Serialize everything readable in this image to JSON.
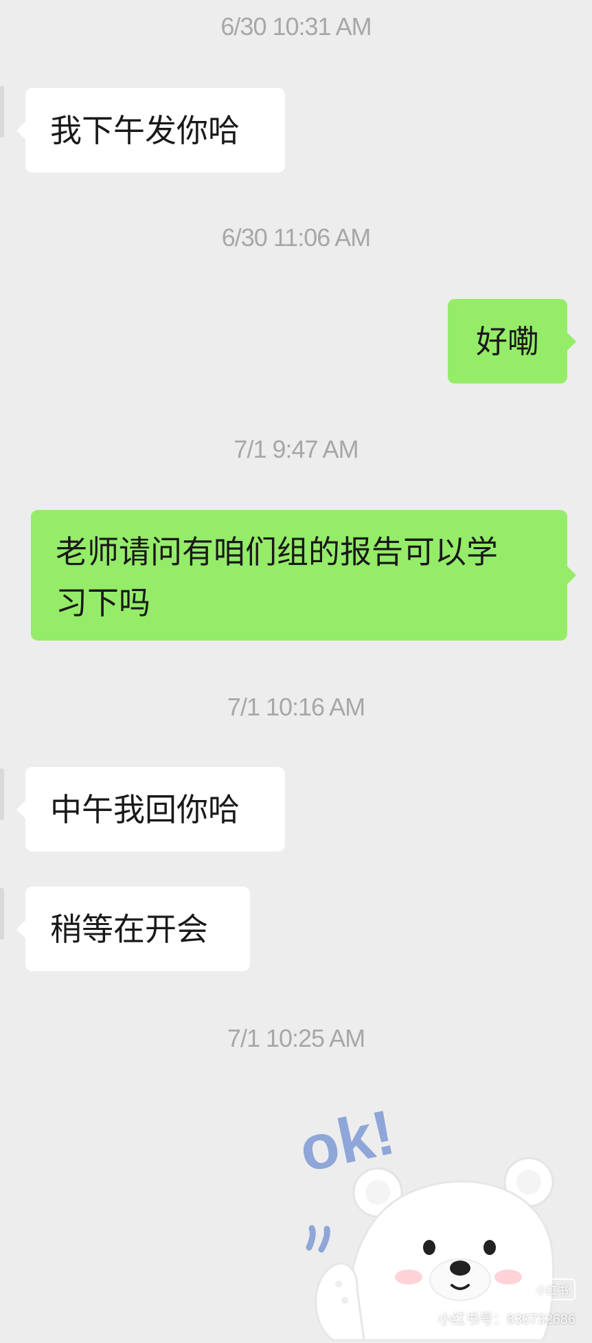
{
  "messages": [
    {
      "time": "6/30 10:31 AM",
      "text": "我下午发你哈",
      "side": "in"
    },
    {
      "time": "6/30 11:06 AM",
      "text": "好嘞",
      "side": "out"
    },
    {
      "time": "7/1 9:47 AM",
      "text": "老师请问有咱们组的报告可以学习下吗",
      "side": "out"
    },
    {
      "time": "7/1 10:16 AM",
      "text": "中午我回你哈",
      "side": "in"
    },
    {
      "text": "稍等在开会",
      "side": "in"
    },
    {
      "time": "7/1 10:25 AM",
      "sticker": "polar-bear-ok-sticker",
      "side": "out"
    }
  ],
  "bubble_lines": {
    "line1": "老师请问有咱们组的报告可以学",
    "line2": "习下吗"
  },
  "sticker": {
    "text": "ok!",
    "icon": "polar-bear-ok-sticker"
  },
  "watermark": {
    "badge": "小红书",
    "text": "小红书号：830732686"
  },
  "colors": {
    "background": "#ededed",
    "incoming_bubble": "#ffffff",
    "outgoing_bubble": "#95ec69",
    "timestamp": "#a7a7a7",
    "sticker_text": "#8fa6d8"
  }
}
